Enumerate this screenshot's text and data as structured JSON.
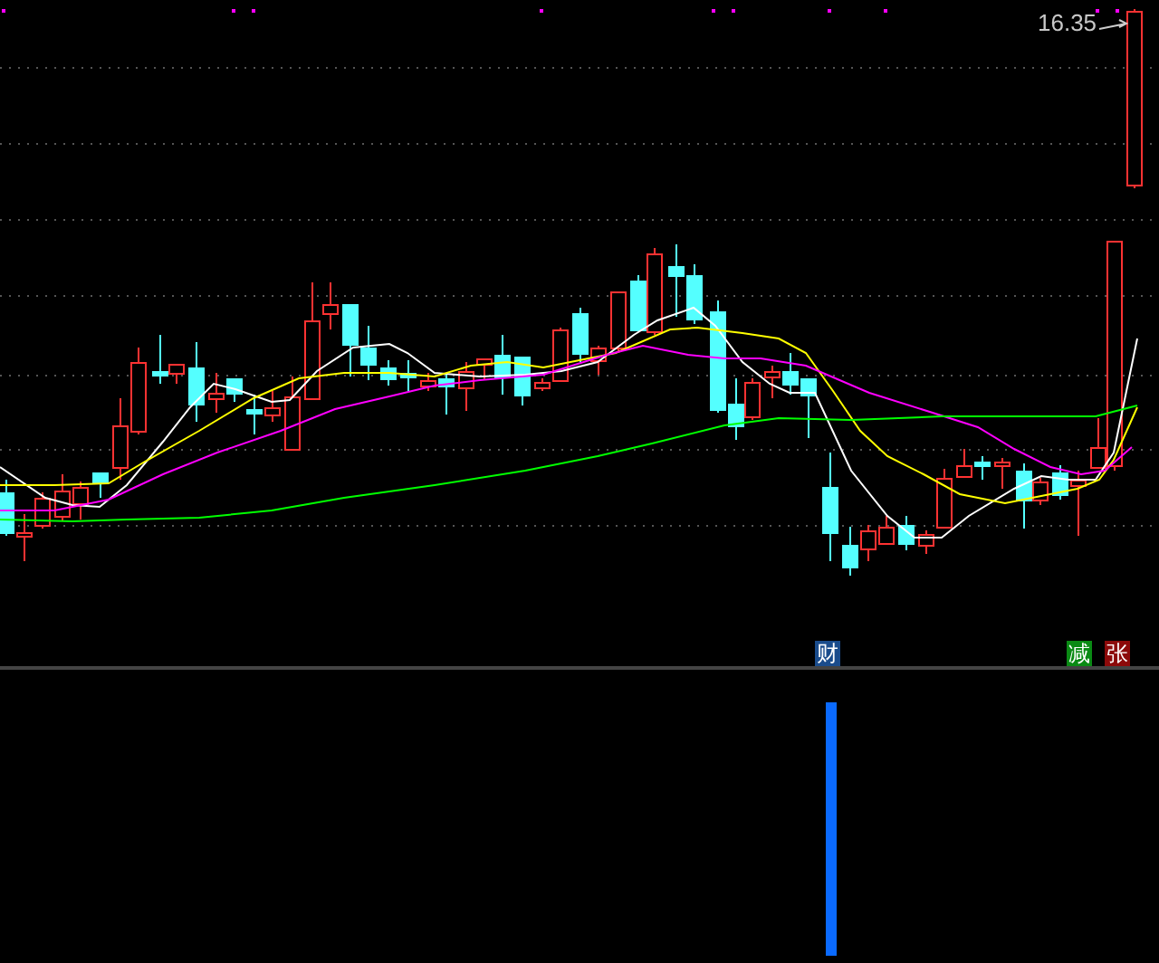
{
  "price_chart": {
    "last_price_label": "16.35"
  },
  "signal_markers": [
    {
      "text": "财",
      "color": "#1a4c8c"
    },
    {
      "text": "减",
      "color": "#0a8a14"
    },
    {
      "text": "张",
      "color": "#8c0a0a"
    }
  ]
}
